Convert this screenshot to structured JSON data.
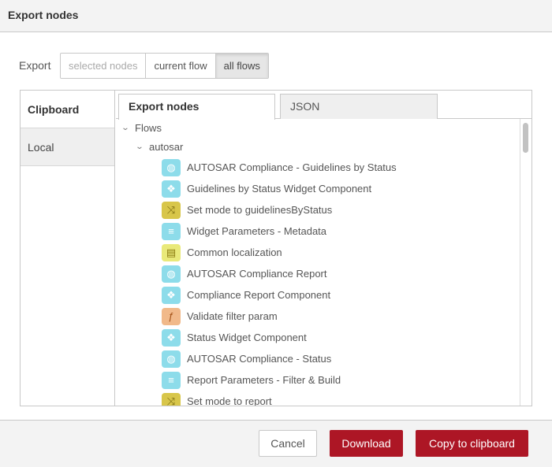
{
  "dialog": {
    "title": "Export nodes"
  },
  "scope": {
    "label": "Export",
    "options": [
      "selected nodes",
      "current flow",
      "all flows"
    ],
    "selected": "all flows"
  },
  "side_tabs": [
    {
      "label": "Clipboard",
      "active": true
    },
    {
      "label": "Local",
      "active": false
    }
  ],
  "top_tabs": [
    {
      "label": "Export nodes",
      "active": true
    },
    {
      "label": "JSON",
      "active": false
    }
  ],
  "tree": {
    "root": "Flows",
    "flow": "autosar",
    "nodes": [
      {
        "label": "AUTOSAR Compliance - Guidelines by Status",
        "icon": "globe-icon"
      },
      {
        "label": "Guidelines by Status Widget Component",
        "icon": "widget-icon"
      },
      {
        "label": "Set mode to guidelinesByStatus",
        "icon": "change-icon"
      },
      {
        "label": "Widget Parameters - Metadata",
        "icon": "template-icon"
      },
      {
        "label": "Common localization",
        "icon": "localize-icon"
      },
      {
        "label": "AUTOSAR Compliance Report",
        "icon": "globe-icon"
      },
      {
        "label": "Compliance Report Component",
        "icon": "widget-icon"
      },
      {
        "label": "Validate filter param",
        "icon": "function-icon"
      },
      {
        "label": "Status Widget Component",
        "icon": "widget-icon"
      },
      {
        "label": "AUTOSAR Compliance - Status",
        "icon": "globe-icon"
      },
      {
        "label": "Report Parameters - Filter & Build",
        "icon": "template-icon"
      },
      {
        "label": "Set mode to report",
        "icon": "change-icon"
      }
    ]
  },
  "footer": {
    "cancel_label": "Cancel",
    "download_label": "Download",
    "copy_label": "Copy to clipboard"
  },
  "colors": {
    "primary": "#ad1625",
    "node_blue": "#8ddcea",
    "node_change": "#d8c64a",
    "node_function": "#f1b98a"
  }
}
